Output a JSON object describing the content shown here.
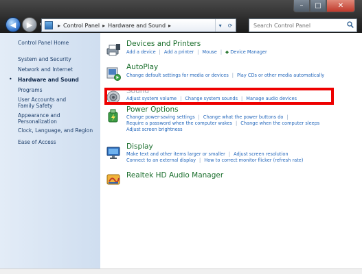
{
  "window": {
    "controls": {
      "minimize": "–",
      "maximize": "□",
      "close": "✕"
    }
  },
  "nav": {
    "back_glyph": "◀",
    "forward_glyph": "▶",
    "dropdown_glyph": "▼"
  },
  "address": {
    "crumbs": [
      "Control Panel",
      "Hardware and Sound"
    ],
    "separator": "▸",
    "dropdown_glyph": "▾",
    "refresh_glyph": "⟳"
  },
  "search": {
    "placeholder": "Search Control Panel"
  },
  "sidebar": {
    "items": [
      {
        "label": "Control Panel Home",
        "current": false
      },
      {
        "label": "System and Security",
        "current": false
      },
      {
        "label": "Network and Internet",
        "current": false
      },
      {
        "label": "Hardware and Sound",
        "current": true
      },
      {
        "label": "Programs",
        "current": false
      },
      {
        "label": "User Accounts and Family Safety",
        "current": false
      },
      {
        "label": "Appearance and Personalization",
        "current": false
      },
      {
        "label": "Clock, Language, and Region",
        "current": false
      },
      {
        "label": "Ease of Access",
        "current": false
      }
    ],
    "bullet": "•"
  },
  "categories": [
    {
      "id": "devices",
      "title": "Devices and Printers",
      "icon": "printer-icon",
      "links": [
        "Add a device",
        "Add a printer",
        "Mouse",
        "Device Manager"
      ]
    },
    {
      "id": "autoplay",
      "title": "AutoPlay",
      "icon": "autoplay-icon",
      "links": [
        "Change default settings for media or devices",
        "Play CDs or other media automatically"
      ]
    },
    {
      "id": "sound",
      "title": "Sound",
      "icon": "speaker-icon",
      "links": [
        "Adjust system volume",
        "Change system sounds",
        "Manage audio devices"
      ]
    },
    {
      "id": "power",
      "title": "Power Options",
      "icon": "power-icon",
      "links": [
        "Change power-saving settings",
        "Change what the power buttons do",
        "Require a password when the computer wakes",
        "Change when the computer sleeps",
        "Adjust screen brightness"
      ]
    },
    {
      "id": "display",
      "title": "Display",
      "icon": "monitor-icon",
      "links": [
        "Make text and other items larger or smaller",
        "Adjust screen resolution",
        "Connect to an external display",
        "How to correct monitor flicker (refresh rate)"
      ]
    },
    {
      "id": "realtek",
      "title": "Realtek HD Audio Manager",
      "icon": "realtek-icon",
      "links": []
    }
  ],
  "colors": {
    "highlight_border": "#ee0000",
    "category_title": "#1a6e2c",
    "link": "#2266bb",
    "sidebar_bg": "#d8e4f3"
  }
}
